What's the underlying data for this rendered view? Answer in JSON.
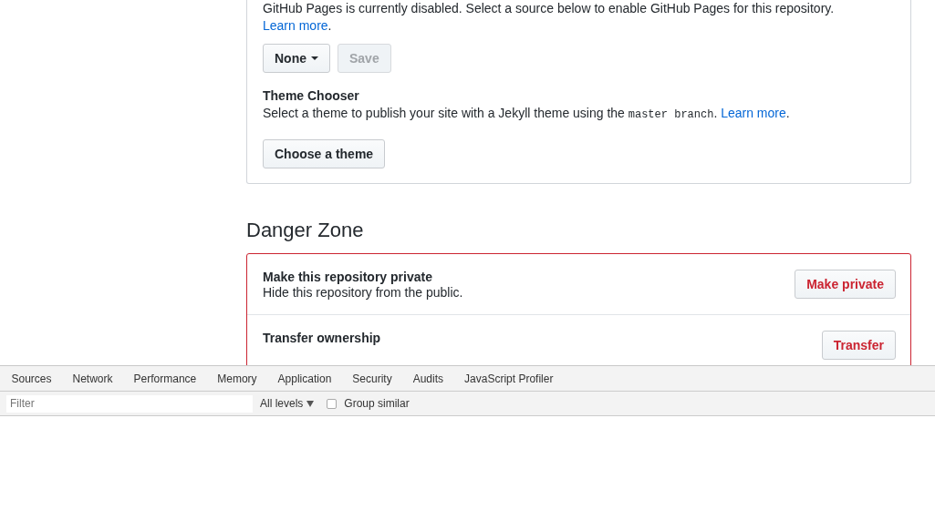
{
  "pages": {
    "notice": "GitHub Pages is currently disabled. Select a source below to enable GitHub Pages for this repository.",
    "notice_link": "Learn more",
    "notice_end": ".",
    "source_button": "None",
    "save_button": {
      "label": "Save",
      "disabled": true
    },
    "theme_chooser": {
      "heading": "Theme Chooser",
      "text_before": "Select a theme to publish your site with a Jekyll theme using the",
      "code": "master branch",
      "code_end": ".",
      "link": "Learn more",
      "link_end": ".",
      "button": "Choose a theme"
    }
  },
  "danger_zone": {
    "title": "Danger Zone",
    "items": [
      {
        "title": "Make this repository private",
        "description": "Hide this repository from the public.",
        "button": "Make private"
      },
      {
        "title": "Transfer ownership",
        "button": "Transfer"
      }
    ]
  },
  "devtools": {
    "tabs": [
      "Sources",
      "Network",
      "Performance",
      "Memory",
      "Application",
      "Security",
      "Audits",
      "JavaScript Profiler"
    ],
    "filter": {
      "placeholder": "Filter"
    },
    "levels": "All levels",
    "group_similar": {
      "label": "Group similar",
      "checked": false
    }
  }
}
